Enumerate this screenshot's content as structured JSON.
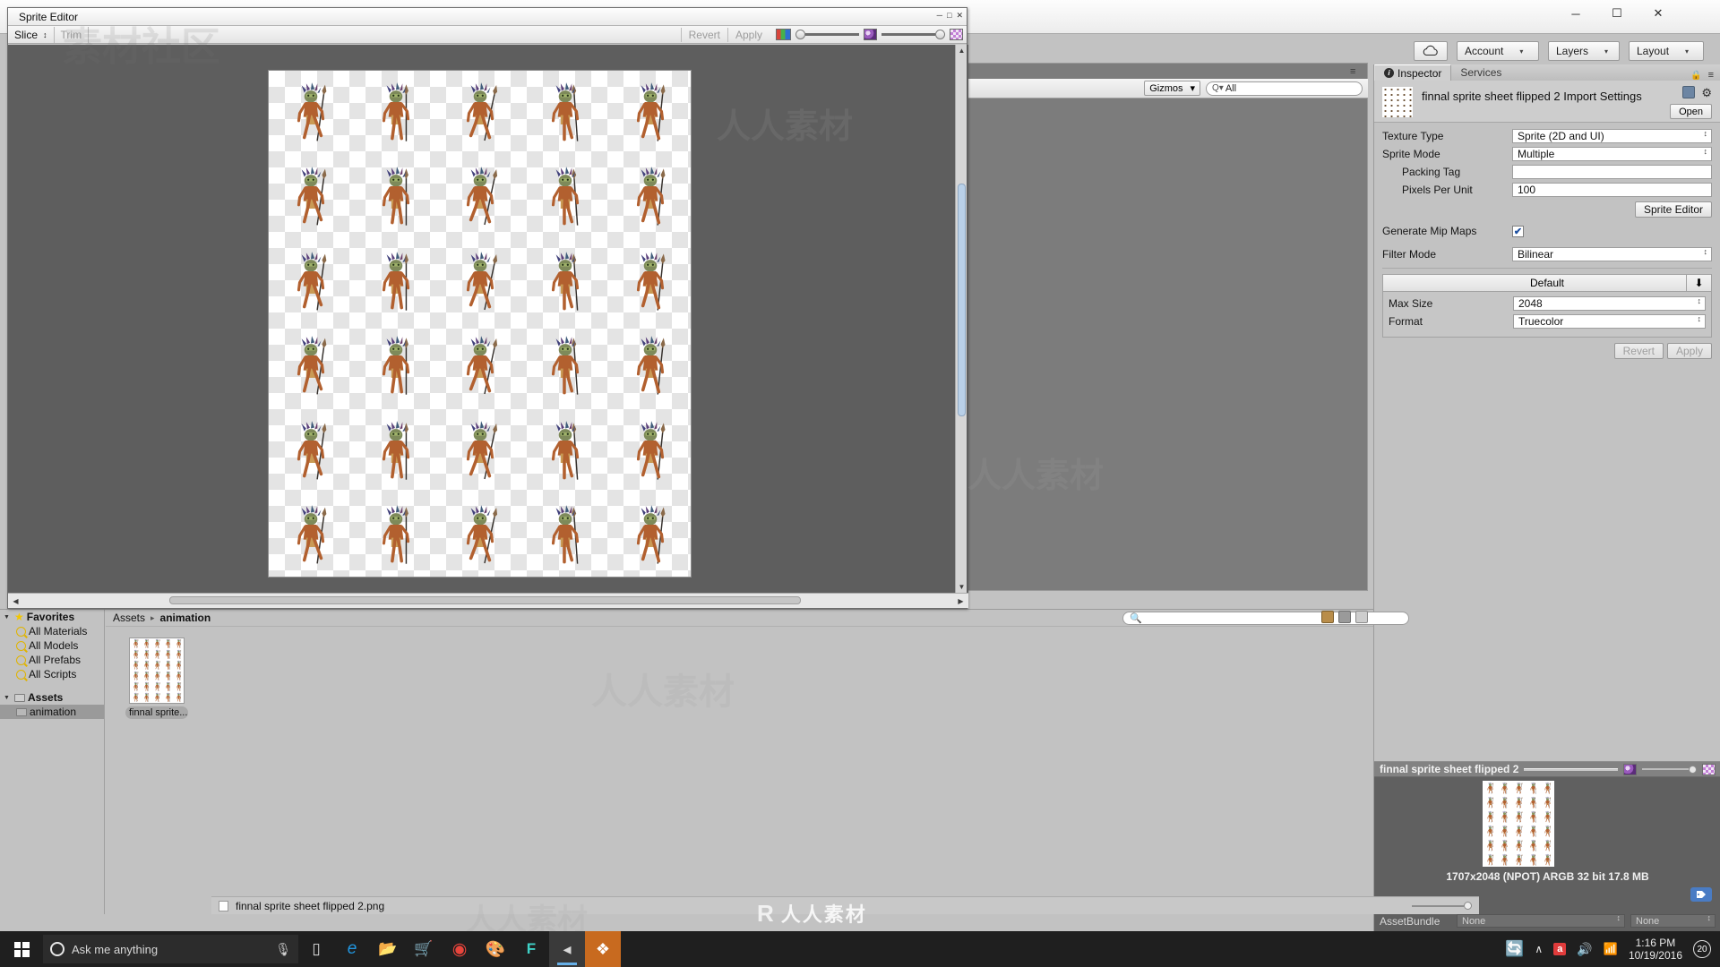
{
  "window": {
    "minimize": "─",
    "maximize": "☐",
    "close": "✕"
  },
  "top_toolbar": {
    "cloud_icon": "cloud-icon",
    "account": "Account",
    "layers": "Layers",
    "layout": "Layout",
    "caret": "▾"
  },
  "scene_view": {
    "gizmos": "Gizmos",
    "gizmos_caret": "▾",
    "search_value": "All",
    "search_icon": "Q▾",
    "menu_icon": "≡"
  },
  "sprite_editor": {
    "title": "Sprite Editor",
    "minimize": "─",
    "maximize": "□",
    "close": "✕",
    "slice_label": "Slice",
    "slice_caret": "↕",
    "trim_label": "Trim",
    "revert_label": "Revert",
    "apply_label": "Apply",
    "color_chip": "rgb-color-chip-icon",
    "alpha_icon": "alpha-checker-icon",
    "sprite_rows": 6,
    "sprite_cols": 5,
    "sheet_background": "#ffffff"
  },
  "inspector": {
    "tab_inspector": "Inspector",
    "tab_services": "Services",
    "lock_icon": "🔒",
    "menu_icon": "≡",
    "asset_title": "finnal sprite sheet flipped 2 Import Settings",
    "open_button": "Open",
    "book_icon": "book-icon",
    "gear_icon": "⚙",
    "fields": [
      {
        "label": "Texture Type",
        "value": "Sprite (2D and UI)",
        "type": "dropdown",
        "indent": false
      },
      {
        "label": "Sprite Mode",
        "value": "Multiple",
        "type": "dropdown",
        "indent": false
      },
      {
        "label": "Packing Tag",
        "value": "",
        "type": "text",
        "indent": true
      },
      {
        "label": "Pixels Per Unit",
        "value": "100",
        "type": "text",
        "indent": true
      }
    ],
    "sprite_editor_button": "Sprite Editor",
    "generate_mip_maps_label": "Generate Mip Maps",
    "generate_mip_maps_checked": true,
    "check_glyph": "✔",
    "filter_mode_label": "Filter Mode",
    "filter_mode_value": "Bilinear",
    "platform_default_tab": "Default",
    "platform_download_icon": "⬇",
    "platform_fields": [
      {
        "label": "Max Size",
        "value": "2048"
      },
      {
        "label": "Format",
        "value": "Truecolor"
      }
    ],
    "revert_label": "Revert",
    "apply_label": "Apply",
    "updown_glyph": "↕"
  },
  "preview": {
    "title": "finnal sprite sheet flipped 2",
    "caption": "1707x2048 (NPOT)  ARGB 32 bit   17.8 MB",
    "tag_icon": "🏷",
    "assetbundle_label": "AssetBundle",
    "assetbundle_value": "None",
    "assetbundle_variant": "None",
    "updown_glyph": "↕"
  },
  "project": {
    "tree": [
      {
        "label": "Favorites",
        "kind": "root-star",
        "bold": true,
        "selected": false
      },
      {
        "label": "All Materials",
        "kind": "search",
        "bold": false,
        "selected": false
      },
      {
        "label": "All Models",
        "kind": "search",
        "bold": false,
        "selected": false
      },
      {
        "label": "All Prefabs",
        "kind": "search",
        "bold": false,
        "selected": false
      },
      {
        "label": "All Scripts",
        "kind": "search",
        "bold": false,
        "selected": false
      },
      {
        "label": "Assets",
        "kind": "root-folder",
        "bold": true,
        "selected": false
      },
      {
        "label": "animation",
        "kind": "folder",
        "bold": false,
        "selected": true
      }
    ],
    "breadcrumb_root": "Assets",
    "breadcrumb_sep": "▸",
    "breadcrumb_current": "animation",
    "asset_name": "finnal sprite...",
    "status_file": "finnal sprite sheet flipped 2.png",
    "search_placeholder": "",
    "toolbar_icons": [
      "create-icon",
      "lock-icon",
      "menu-icon"
    ]
  },
  "taskbar": {
    "start_icon": "windows-start-icon",
    "cortana_placeholder": "Ask me anything",
    "mic_icon": "🎙",
    "task_view_icon": "task-view-icon",
    "apps": [
      {
        "name": "edge-icon",
        "glyph": "e",
        "color": "#1f9ae0",
        "active": false
      },
      {
        "name": "file-explorer-icon",
        "glyph": "▤",
        "color": "#f3c34a",
        "active": false
      },
      {
        "name": "store-icon",
        "glyph": "▣",
        "color": "#f0f0f0",
        "active": false
      },
      {
        "name": "chrome-icon",
        "glyph": "●",
        "color": "#e8453c",
        "active": false
      },
      {
        "name": "paint-icon",
        "glyph": "◐",
        "color": "#d8d8d8",
        "active": false
      },
      {
        "name": "flash-icon",
        "glyph": "F",
        "color": "#3fd2c7",
        "active": false
      },
      {
        "name": "unity-hub-icon",
        "glyph": "◀",
        "color": "#cfcfcf",
        "active": true
      },
      {
        "name": "unity-icon",
        "glyph": "❖",
        "color": "#ffffff",
        "active": true
      }
    ],
    "tray": {
      "update_icon": "update-icon",
      "chevron": "∧",
      "antivirus_icon": "a",
      "volume_icon": "🔊",
      "wifi_icon": "📶",
      "time": "1:16 PM",
      "date": "10/19/2016",
      "notification_count": "20"
    }
  },
  "watermarks": {
    "cn_text": "人人素材",
    "cn_subtext": "素材社区",
    "brand": "人人素材",
    "logo": "R"
  },
  "colors": {
    "unity_chrome": "#c2c2c2",
    "scene_gray": "#7c7c7c",
    "canvas_gray": "#5e5e5e",
    "preview_dark": "#606060",
    "selection": "#9a9a9a",
    "taskbar": "#1f1f1f",
    "unity_active": "#c86a1f",
    "scroll_thumb": "#b9d0e8"
  }
}
